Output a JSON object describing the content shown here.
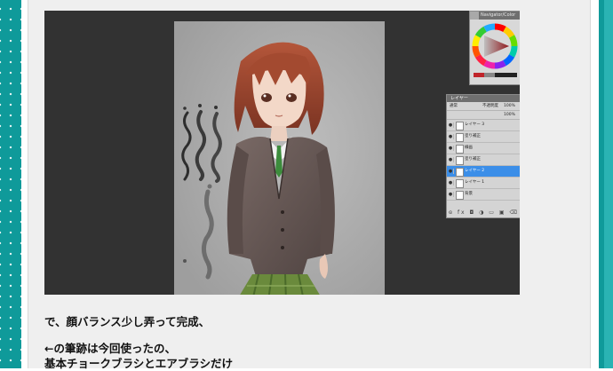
{
  "color_panel": {
    "title": "Navigator/Color"
  },
  "layers_panel": {
    "title": "レイヤー",
    "blend_mode": "通常",
    "opacity_label": "不透明度",
    "opacity_value": "100%",
    "fill_value": "100%",
    "layers": [
      {
        "name": "レイヤー 3",
        "selected": false
      },
      {
        "name": "塗り補正",
        "selected": false
      },
      {
        "name": "線画",
        "selected": false
      },
      {
        "name": "塗り補正",
        "selected": false
      },
      {
        "name": "レイヤー 2",
        "selected": true
      },
      {
        "name": "レイヤー 1",
        "selected": false
      },
      {
        "name": "背景",
        "selected": false
      }
    ],
    "footer_icons": "ɞ fx ◘ ◑ ▭ ▣ ⌫"
  },
  "article": {
    "line1": "で、顔バランス少し弄って完成、",
    "line2": "←の筆跡は今回使ったの、",
    "line3": "基本チョークブラシとエアブラシだけ"
  },
  "colors": {
    "teal": "#0f9a9a",
    "panel_bg": "#efefef",
    "workspace": "#323232",
    "canvas": "#a8a8a8",
    "selected_layer": "#3b8ee8"
  }
}
